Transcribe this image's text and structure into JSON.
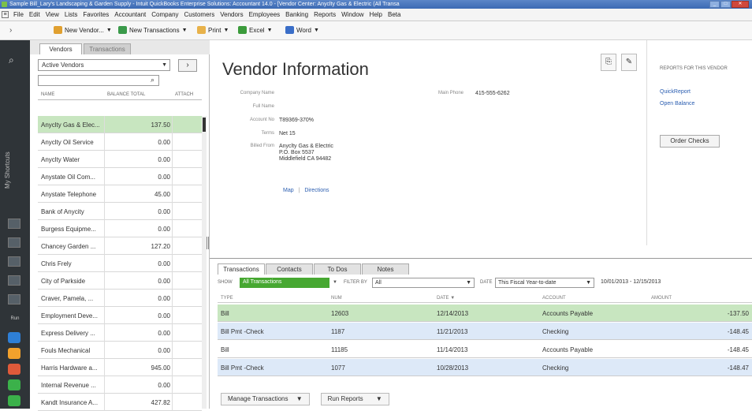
{
  "window": {
    "title": "Sample Bill_Lary's Landscaping & Garden Supply - Intuit QuickBooks Enterprise Solutions: Accountant 14.0 - [Vendor Center: Anyclty Gas & Electric (All Transa",
    "buttons": [
      "_",
      "□",
      "✕"
    ]
  },
  "menubar": [
    "File",
    "Edit",
    "View",
    "Lists",
    "Favorites",
    "Accountant",
    "Company",
    "Customers",
    "Vendors",
    "Employees",
    "Banking",
    "Reports",
    "Window",
    "Help",
    "Beta"
  ],
  "toolbar": {
    "new_vendor": "New Vendor...",
    "new_transactions": "New Transactions",
    "print": "Print",
    "excel": "Excel",
    "word": "Word"
  },
  "iconbar": {
    "shortcuts_label": "My Shortcuts",
    "run_label": "Run"
  },
  "left_panel": {
    "tab_vendors": "Vendors",
    "tab_transactions": "Transactions",
    "filter_value": "Active Vendors",
    "columns": [
      "NAME",
      "BALANCE TOTAL",
      "ATTACH"
    ],
    "rows": [
      {
        "name": "Anyclty Gas & Elec...",
        "balance": "137.50"
      },
      {
        "name": "Anyclty Oil Service",
        "balance": "0.00"
      },
      {
        "name": "Anyclty Water",
        "balance": "0.00"
      },
      {
        "name": "Anystate Oil Com...",
        "balance": "0.00"
      },
      {
        "name": "Anystate Telephone",
        "balance": "45.00"
      },
      {
        "name": "Bank of Anycity",
        "balance": "0.00"
      },
      {
        "name": "Burgess Equipme...",
        "balance": "0.00"
      },
      {
        "name": "Chancey Garden ...",
        "balance": "127.20"
      },
      {
        "name": "Chris Frely",
        "balance": "0.00"
      },
      {
        "name": "City of Parkside",
        "balance": "0.00"
      },
      {
        "name": "Craver, Pamela, ...",
        "balance": "0.00"
      },
      {
        "name": "Employment Deve...",
        "balance": "0.00"
      },
      {
        "name": "Express Delivery ...",
        "balance": "0.00"
      },
      {
        "name": "Fouls Mechanical",
        "balance": "0.00"
      },
      {
        "name": "Harris Hardware a...",
        "balance": "945.00"
      },
      {
        "name": "Internal Revenue ...",
        "balance": "0.00"
      },
      {
        "name": "Kandt Insurance A...",
        "balance": "427.82"
      }
    ]
  },
  "vendor_info": {
    "title": "Vendor Information",
    "labels": {
      "company_name": "Company Name",
      "full_name": "Full Name",
      "account_no": "Account No",
      "terms": "Terms",
      "billed_from": "Billed From",
      "main_phone": "Main Phone"
    },
    "account_no": "T89369-370%",
    "terms": "Net 15",
    "billed_from": [
      "Anyclty Gas & Electric",
      "P.O. Box 5537",
      "Middlefield CA 94482"
    ],
    "main_phone": "415-555-6262",
    "map": "Map",
    "directions": "Directions"
  },
  "reports": {
    "title": "REPORTS FOR THIS VENDOR",
    "links": [
      "QuickReport",
      "Open Balance"
    ],
    "order_checks": "Order Checks"
  },
  "transactions": {
    "tabs": [
      "Transactions",
      "Contacts",
      "To Dos",
      "Notes"
    ],
    "show_label": "SHOW",
    "show_value": "All Transactions",
    "filter_label": "FILTER BY",
    "filter_value": "All",
    "date_label": "DATE",
    "date_value": "This Fiscal Year-to-date",
    "date_range": "10/01/2013 - 12/15/2013",
    "columns": [
      "TYPE",
      "NUM",
      "DATE ▼",
      "ACCOUNT",
      "AMOUNT"
    ],
    "rows": [
      {
        "type": "Bill",
        "num": "12603",
        "date": "12/14/2013",
        "account": "Accounts Payable",
        "amount": "-137.50"
      },
      {
        "type": "Bill Pmt -Check",
        "num": "1187",
        "date": "11/21/2013",
        "account": "Checking",
        "amount": "-148.45"
      },
      {
        "type": "Bill",
        "num": "11185",
        "date": "11/14/2013",
        "account": "Accounts Payable",
        "amount": "-148.45"
      },
      {
        "type": "Bill Pmt -Check",
        "num": "1077",
        "date": "10/28/2013",
        "account": "Checking",
        "amount": "-148.47"
      }
    ],
    "manage_button": "Manage Transactions",
    "run_reports_button": "Run Reports"
  },
  "colors": {
    "selected_row": "#c8e6c0",
    "show_green": "#47a832",
    "blue_row": "#dde9f8",
    "link": "#2a5db0"
  }
}
